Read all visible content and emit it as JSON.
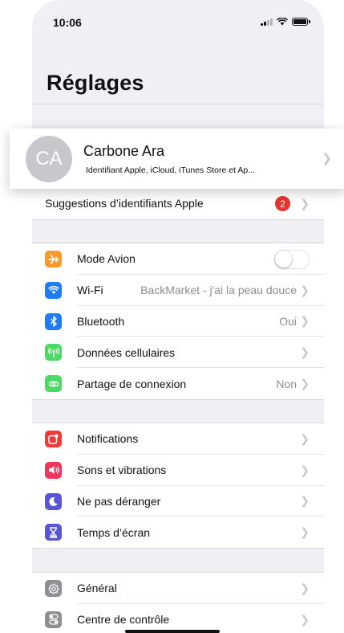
{
  "status_bar": {
    "time": "10:06"
  },
  "page": {
    "title": "Réglages"
  },
  "profile": {
    "initials": "CA",
    "name": "Carbone Ara",
    "subtitle": "Identifiant Apple, iCloud, iTunes Store et Ap..."
  },
  "suggestions": {
    "label": "Suggestions d’identifiants Apple",
    "badge": "2"
  },
  "connectivity": [
    {
      "label": "Mode Avion",
      "icon": "airplane-icon",
      "color": "#f79a2a",
      "toggle_on": false
    },
    {
      "label": "Wi-Fi",
      "icon": "wifi-icon",
      "color": "#1f7cf6",
      "value": "BackMarket - j'ai la peau douce"
    },
    {
      "label": "Bluetooth",
      "icon": "bluetooth-icon",
      "color": "#1f7cf6",
      "value": "Oui"
    },
    {
      "label": "Données cellulaires",
      "icon": "antenna-icon",
      "color": "#4cd964",
      "value": ""
    },
    {
      "label": "Partage de connexion",
      "icon": "chain-icon",
      "color": "#4cd964",
      "value": "Non"
    }
  ],
  "alerts": [
    {
      "label": "Notifications",
      "icon": "notifications-icon",
      "color": "#f23a37"
    },
    {
      "label": "Sons et vibrations",
      "icon": "speaker-icon",
      "color": "#f2365b"
    },
    {
      "label": "Ne pas déranger",
      "icon": "moon-icon",
      "color": "#5856d6"
    },
    {
      "label": "Temps d’écran",
      "icon": "hourglass-icon",
      "color": "#5856d6"
    }
  ],
  "general": [
    {
      "label": "Général",
      "icon": "gear-icon",
      "color": "#8e8e93"
    },
    {
      "label": "Centre de contrôle",
      "icon": "switches-icon",
      "color": "#8e8e93"
    }
  ]
}
